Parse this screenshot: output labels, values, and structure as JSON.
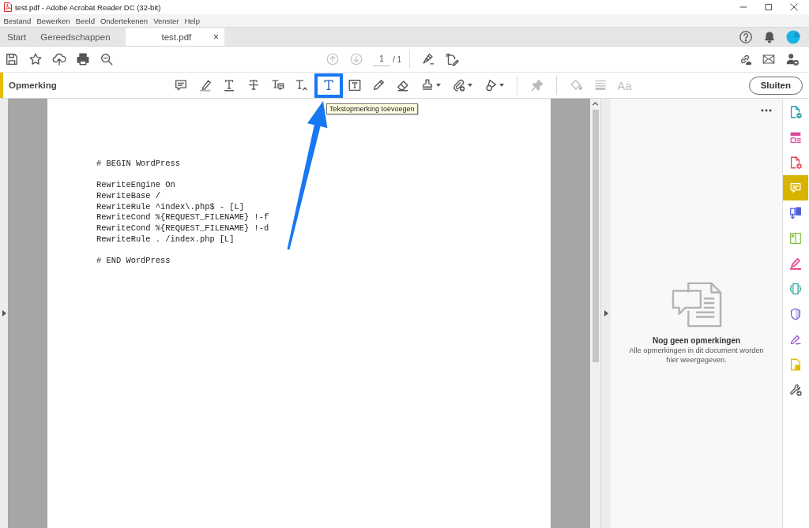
{
  "window": {
    "title": "test.pdf - Adobe Acrobat Reader DC (32-bit)"
  },
  "menu": [
    "Bestand",
    "Bewerken",
    "Beeld",
    "Ondertekenen",
    "Venster",
    "Help"
  ],
  "tabs": [
    {
      "label": "Start",
      "selected": false
    },
    {
      "label": "Gereedschappen",
      "selected": false
    },
    {
      "label": "test.pdf",
      "selected": true,
      "close": "×"
    }
  ],
  "toolbar": {
    "page_nav": [
      {
        "disabled": true
      },
      {
        "disabled": true
      }
    ],
    "page_field": {
      "value": "1"
    },
    "page_count": "/ 1"
  },
  "comment_toolbar": {
    "title": "Opmerking",
    "tool_groups": [
      [
        {
          "kind": "speech",
          "selected": false,
          "disabled": false,
          "highlighted": false,
          "menu": false
        },
        {
          "kind": "marker",
          "selected": false,
          "disabled": false,
          "highlighted": false,
          "menu": false
        },
        {
          "kind": "underline",
          "selected": false,
          "disabled": false,
          "highlighted": false,
          "menu": false
        },
        {
          "kind": "strike",
          "selected": false,
          "disabled": false,
          "highlighted": false,
          "menu": false
        },
        {
          "kind": "t-bubble",
          "selected": false,
          "disabled": false,
          "highlighted": false,
          "menu": false
        },
        {
          "kind": "t-caret",
          "selected": false,
          "disabled": false,
          "highlighted": false,
          "menu": false
        },
        {
          "kind": "text",
          "selected": true,
          "disabled": false,
          "highlighted": true,
          "menu": false
        },
        {
          "kind": "text-box",
          "selected": false,
          "disabled": false,
          "highlighted": false,
          "menu": false
        },
        {
          "kind": "pencil",
          "selected": false,
          "disabled": false,
          "highlighted": false,
          "menu": false
        },
        {
          "kind": "eraser",
          "selected": false,
          "disabled": false,
          "highlighted": false,
          "menu": false
        },
        {
          "kind": "stamp",
          "selected": false,
          "disabled": false,
          "highlighted": false,
          "menu": true
        },
        {
          "kind": "clip",
          "selected": false,
          "disabled": false,
          "highlighted": false,
          "menu": true
        },
        {
          "kind": "shapes",
          "selected": false,
          "disabled": false,
          "highlighted": false,
          "menu": true
        }
      ],
      [
        {
          "kind": "pin",
          "selected": false,
          "disabled": true,
          "highlighted": false,
          "menu": false
        }
      ],
      [
        {
          "kind": "bucket",
          "selected": false,
          "disabled": true,
          "highlighted": false,
          "menu": false
        },
        {
          "kind": "lines",
          "selected": false,
          "disabled": true,
          "highlighted": false,
          "menu": false
        },
        {
          "kind": "label",
          "label": "Aa",
          "selected": false,
          "disabled": true,
          "highlighted": false,
          "menu": false
        }
      ]
    ],
    "tooltip": "Tekstopmerking toevoegen",
    "close_button": "Sluiten"
  },
  "document": {
    "blocks": [
      [
        "# BEGIN WordPress"
      ],
      [
        "RewriteEngine On",
        "RewriteBase /",
        "RewriteRule ^index\\.php$ - [L]",
        "RewriteCond %{REQUEST_FILENAME} !-f",
        "RewriteCond %{REQUEST_FILENAME} !-d",
        "RewriteRule . /index.php [L]"
      ],
      [
        "# END WordPress"
      ]
    ]
  },
  "comments_panel": {
    "empty_title": "Nog geen opmerkingen",
    "empty_text": "Alle opmerkingen in dit document worden hier weergegeven."
  },
  "right_rail": [
    {
      "kind": "doc-arrow",
      "selected": false
    },
    {
      "kind": "layout",
      "selected": false
    },
    {
      "kind": "doc-plus",
      "selected": false
    },
    {
      "kind": "speech",
      "selected": true
    },
    {
      "kind": "docs-arrow",
      "selected": false
    },
    {
      "kind": "split",
      "selected": false
    },
    {
      "kind": "pen",
      "selected": false
    },
    {
      "kind": "doc-braces",
      "selected": false
    },
    {
      "kind": "shield",
      "selected": false
    },
    {
      "kind": "signature",
      "selected": false
    },
    {
      "kind": "doc-note",
      "selected": false
    },
    {
      "kind": "wrench-plus",
      "selected": false
    }
  ]
}
